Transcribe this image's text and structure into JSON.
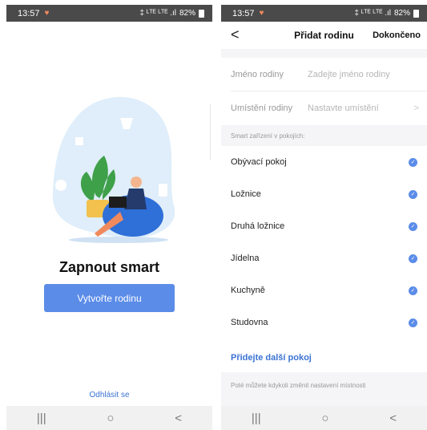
{
  "left_screen": {
    "status": {
      "time": "13:57",
      "signal": "‡ ᴸᵀᴱ ᴸᵀᴱ .ıl",
      "battery": "82%"
    },
    "headline": "Zapnout smart",
    "cta_label": "Vytvořte rodinu",
    "logout_label": "Odhlásit se",
    "nav": {
      "recent": "|||",
      "home": "○",
      "back": "<"
    }
  },
  "right_screen": {
    "status": {
      "time": "13:57",
      "signal": "‡ ᴸᵀᴱ ᴸᵀᴱ .ıl",
      "battery": "82%"
    },
    "header": {
      "back": "<",
      "title": "Přidat rodinu",
      "done": "Dokončeno"
    },
    "form": {
      "name_label": "Jméno rodiny",
      "name_placeholder": "Zadejte jméno rodiny",
      "location_label": "Umístění rodiny",
      "location_placeholder": "Nastavte umístění",
      "chevron": ">"
    },
    "rooms_header": "Smart zařízení v pokojích:",
    "rooms": [
      {
        "label": "Obývací pokoj",
        "checked": true
      },
      {
        "label": "Ložnice",
        "checked": true
      },
      {
        "label": "Druhá ložnice",
        "checked": true
      },
      {
        "label": "Jídelna",
        "checked": true
      },
      {
        "label": "Kuchyně",
        "checked": true
      },
      {
        "label": "Studovna",
        "checked": true
      }
    ],
    "add_room_label": "Přidejte další pokoj",
    "footer_note": "Poté můžete kdykoli změnit nastavení místnosti",
    "nav": {
      "recent": "|||",
      "home": "○",
      "back": "<"
    }
  },
  "colors": {
    "accent": "#5b8ce8",
    "link": "#3b73d4",
    "status_bar": "#4a4a4a",
    "illustration_blob": "#dfeefa"
  }
}
